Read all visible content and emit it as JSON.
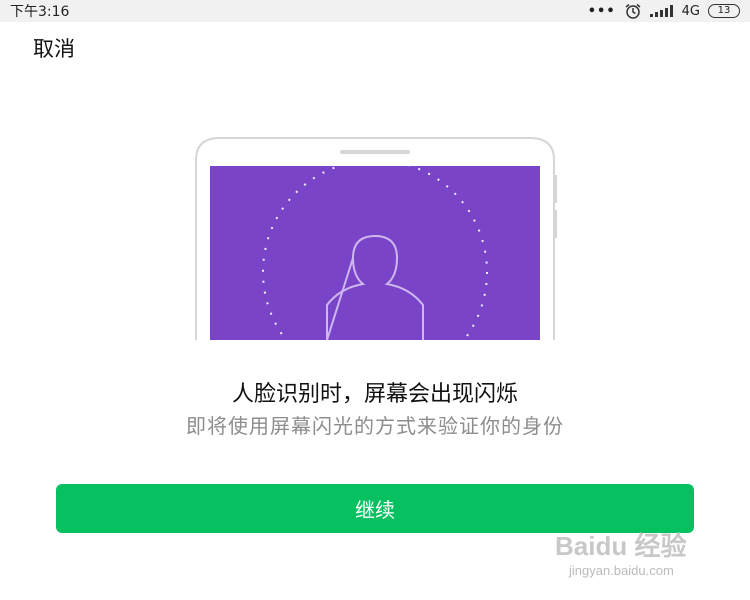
{
  "status_bar": {
    "time": "下午3:16",
    "dots": "•••",
    "network": "4G",
    "battery": "13"
  },
  "header": {
    "cancel_label": "取消"
  },
  "main": {
    "title": "人脸识别时，屏幕会出现闪烁",
    "subtitle": "即将使用屏幕闪光的方式来验证你的身份",
    "continue_label": "继续"
  },
  "watermark": {
    "brand": "Baidu 经验",
    "url": "jingyan.baidu.com"
  },
  "colors": {
    "accent": "#07c160",
    "screen_purple": "#7a44c9"
  },
  "icons": [
    "alarm-icon",
    "signal-icon",
    "battery-icon",
    "face-silhouette-icon"
  ]
}
